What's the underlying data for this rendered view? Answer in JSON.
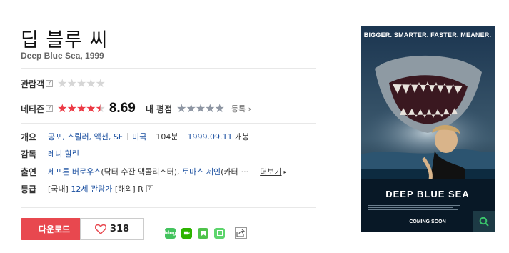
{
  "movie": {
    "title": "딥 블루 씨",
    "subtitle": "Deep Blue Sea, 1999"
  },
  "ratings": {
    "audience_label": "관람객",
    "audience_rating": 0,
    "netizen_label": "네티즌",
    "netizen_rating": 8.69,
    "netizen_score": "8.69",
    "my_rating_label": "내 평점",
    "my_rating": 0,
    "register_label": "등록",
    "help_mark": "?"
  },
  "info": {
    "summary_label": "개요",
    "genres": "공포, 스릴러, 액션, SF",
    "country": "미국",
    "runtime": "104분",
    "release_date": "1999.09.11",
    "release_suffix": "개봉",
    "director_label": "감독",
    "director": "레니 할린",
    "cast_label": "출연",
    "cast_1": "세프론 버로우스",
    "cast_1_role": "(닥터 수잔 맥콜리스터),",
    "cast_2": "토마스 제인",
    "cast_2_role": "(카터",
    "ellipsis": "···",
    "more_label": "더보기",
    "grade_label": "등급",
    "grade_domestic_prefix": "[국내]",
    "grade_domestic": "12세 관람가",
    "grade_overseas_prefix": "[해외]",
    "grade_overseas": "R"
  },
  "actions": {
    "download_label": "다운로드",
    "like_count": "318"
  },
  "share": {
    "icons": [
      "blog-icon",
      "cafe-icon",
      "band-icon",
      "memo-icon",
      "share-icon"
    ],
    "blog_text": "blog"
  },
  "poster": {
    "tagline": "BIGGER. SMARTER. FASTER. MEANER.",
    "title": "DEEP BLUE SEA",
    "coming": "COMING SOON"
  },
  "colors": {
    "accent_red": "#e8484f",
    "star_red": "#ec3a45",
    "star_gray": "#8e96a3",
    "link_blue": "#1a4fa0"
  }
}
